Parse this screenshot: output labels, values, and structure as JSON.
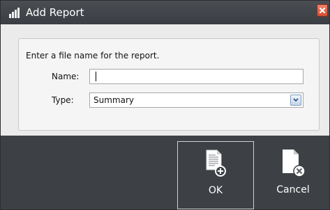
{
  "window": {
    "title": "Add Report"
  },
  "titlebar_icons": {
    "app": "bar-chart-icon",
    "close": "close-icon"
  },
  "form": {
    "prompt": "Enter a file name for the report.",
    "name_label": "Name:",
    "name_value": "",
    "type_label": "Type:",
    "type_value": "Summary"
  },
  "actions": {
    "ok": {
      "label": "OK",
      "icon": "new-document-add-icon"
    },
    "cancel": {
      "label": "Cancel",
      "icon": "document-cancel-icon"
    }
  },
  "colors": {
    "titlebar": "#3a3e43",
    "footer": "#3d4145",
    "close_button": "#d44d30",
    "panel": "#f5f5f5"
  }
}
